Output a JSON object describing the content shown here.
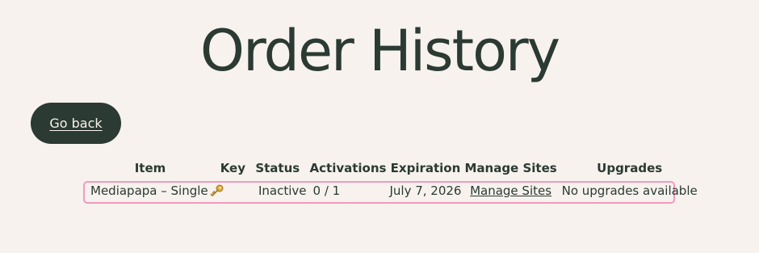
{
  "header": {
    "title": "Order History"
  },
  "nav": {
    "go_back_label": "Go back"
  },
  "table": {
    "columns": [
      "Item",
      "Key",
      "Status",
      "Activations",
      "Expiration",
      "Manage Sites",
      "Upgrades"
    ],
    "rows": [
      {
        "item": "Mediapapa – Single",
        "key_icon": "key-icon",
        "status": "Inactive",
        "activations": "0 / 1",
        "expiration": "July 7, 2026",
        "manage_sites": "Manage Sites",
        "upgrades": "No upgrades available"
      }
    ]
  },
  "colors": {
    "background": "#f7f2ee",
    "text": "#2b3a33",
    "button_bg": "#2b3a33",
    "row_highlight": "#f19ac0",
    "key_icon": "#c89a2a"
  }
}
